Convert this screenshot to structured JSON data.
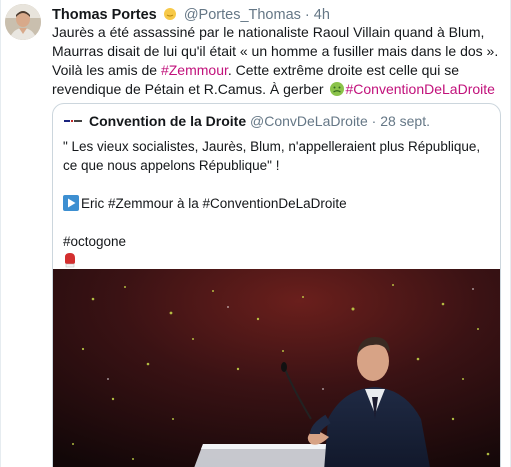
{
  "tweet": {
    "author_name": "Thomas Portes",
    "author_emoji": "sun-emoji",
    "handle": "@Portes_Thomas",
    "separator": "·",
    "time": "4h",
    "text": {
      "part1": "Jaurès a été assassiné par le nationaliste Raoul Villain quand à Blum, Maurras disait de lui qu'il était « un homme a fusiller mais dans le dos ». Voilà les amis de ",
      "link1": "#Zemmour",
      "part2": ".  Cette extrême droite est celle qui se revendique de Pétain et R.Camus. À gerber ",
      "emoji": "nauseated-face-emoji",
      "link2": "#ConventionDeLaDroite"
    }
  },
  "quoted": {
    "name": "Convention de la Droite",
    "handle": "@ConvDeLaDroite",
    "separator": "·",
    "date": "28 sept.",
    "line1": "\" Les vieux socialistes, Jaurès, Blum, n'appelleraient plus République, ce que nous appelons République\" !",
    "line2_text": "Eric ",
    "line2_link1": "#Zemmour",
    "line2_mid": " à la ",
    "line2_link2": "#ConventionDeLaDroite",
    "line3": "#octogone",
    "line4_emoji": "boxing-glove-emoji",
    "image_alt": "Speaker at a podium with microphone on stage"
  },
  "colors": {
    "link": "#c1117b",
    "text": "#14171a",
    "secondary": "#657786",
    "border": "#ccd6dd"
  }
}
